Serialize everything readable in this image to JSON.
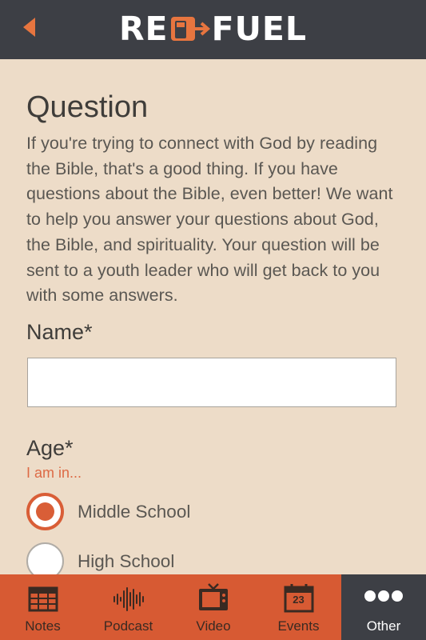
{
  "header": {
    "back_icon": "back-arrow-icon",
    "logo_left": "RE",
    "logo_icon": "fuel-pump-icon",
    "logo_right": "FUEL",
    "accent_color": "#e7753f"
  },
  "main": {
    "title": "Question",
    "intro": "If you're trying to connect with God by reading the Bible, that's a good thing. If you have questions about the Bible, even better! We want to help you answer your questions about God, the Bible, and spirituality. Your question will be sent to a youth leader who will get back to you with some answers.",
    "name_label": "Name*",
    "name_value": "",
    "name_placeholder": "",
    "age_label": "Age*",
    "age_hint": "I am in...",
    "age_options": [
      {
        "label": "Middle School",
        "selected": true
      },
      {
        "label": "High School",
        "selected": false
      }
    ]
  },
  "tabbar": {
    "tabs": [
      {
        "label": "Notes",
        "icon": "notes-icon",
        "active": false
      },
      {
        "label": "Podcast",
        "icon": "podcast-waveform-icon",
        "active": false
      },
      {
        "label": "Video",
        "icon": "tv-icon",
        "active": false
      },
      {
        "label": "Events",
        "icon": "calendar-icon",
        "active": false,
        "badge": "23"
      },
      {
        "label": "Other",
        "icon": "more-dots-icon",
        "active": true
      }
    ],
    "bg_color": "#d75a33",
    "active_bg_color": "#3d3f45"
  }
}
